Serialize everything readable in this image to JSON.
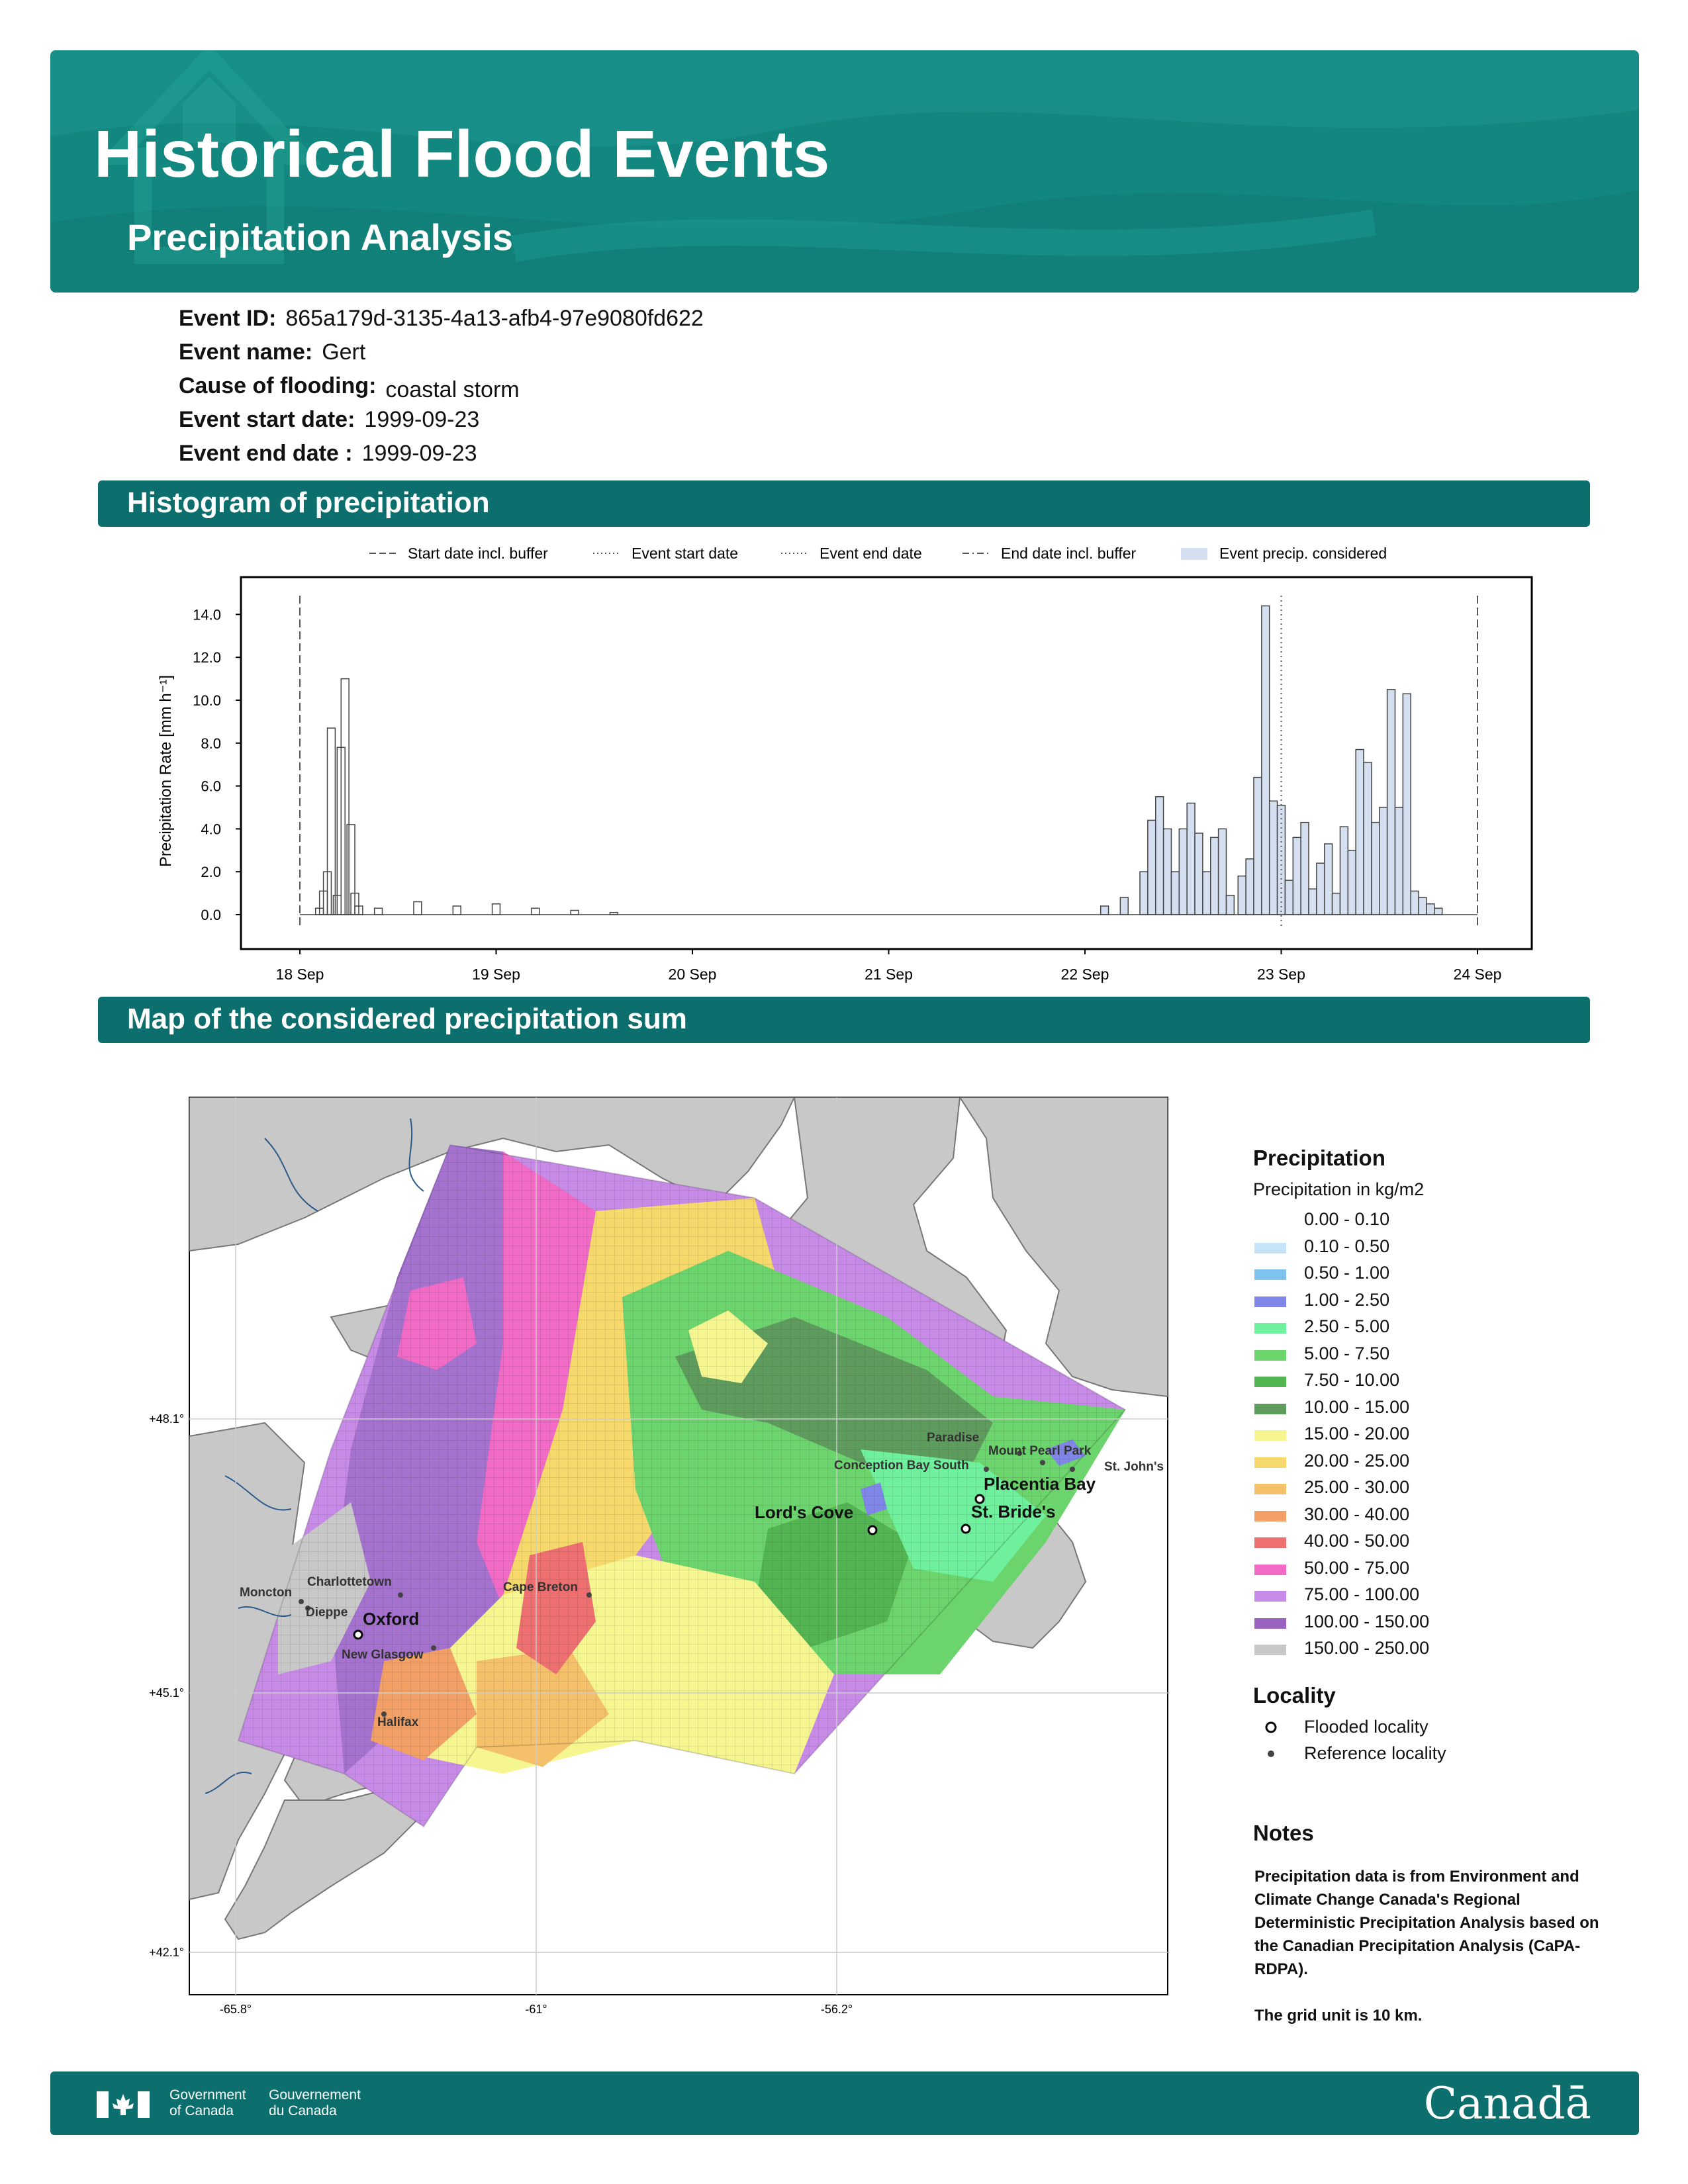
{
  "header": {
    "title": "Historical Flood Events",
    "subtitle": "Precipitation Analysis"
  },
  "event": {
    "id_label": "Event ID:",
    "id": "865a179d-3135-4a13-afb4-97e9080fd622",
    "name_label": "Event name:",
    "name": "Gert",
    "cause_label": "Cause of flooding:",
    "cause": "coastal storm",
    "start_label": "Event start date:",
    "start": "1999-09-23",
    "end_label": "Event end date :",
    "end": "1999-09-23"
  },
  "sections": {
    "histogram": "Histogram of precipitation",
    "map": "Map of the considered precipitation sum"
  },
  "chart_data": {
    "type": "bar",
    "ylabel": "Precipitation Rate [mm h⁻¹]",
    "ylim": [
      -1.5,
      16
    ],
    "yticks": [
      "0.0",
      "2.0",
      "4.0",
      "6.0",
      "8.0",
      "10.0",
      "12.0",
      "14.0"
    ],
    "xticks": [
      "18 Sep",
      "19 Sep",
      "20 Sep",
      "21 Sep",
      "22 Sep",
      "23 Sep",
      "24 Sep"
    ],
    "legend": [
      "Start date incl. buffer",
      "Event start date",
      "Event end date",
      "End date incl. buffer",
      "Event precip. considered"
    ],
    "markers": {
      "start_buffer": "18 Sep",
      "event_start": "23 Sep",
      "event_end": "23 Sep",
      "end_buffer": "24 Sep"
    },
    "series": [
      {
        "points": [
          [
            0.1,
            0.3
          ],
          [
            0.12,
            1.1
          ],
          [
            0.14,
            2.0
          ],
          [
            0.16,
            8.7
          ],
          [
            0.19,
            0.9
          ],
          [
            0.21,
            7.8
          ],
          [
            0.23,
            11.0
          ],
          [
            0.26,
            4.2
          ],
          [
            0.28,
            1.0
          ],
          [
            0.3,
            0.4
          ],
          [
            0.4,
            0.3
          ],
          [
            0.6,
            0.6
          ],
          [
            0.8,
            0.4
          ],
          [
            1.0,
            0.5
          ],
          [
            1.2,
            0.3
          ],
          [
            1.4,
            0.2
          ],
          [
            1.6,
            0.1
          ]
        ]
      },
      {
        "points": [
          [
            4.1,
            0.4
          ],
          [
            4.2,
            0.8
          ],
          [
            4.3,
            2.0
          ],
          [
            4.34,
            4.4
          ],
          [
            4.38,
            5.5
          ],
          [
            4.42,
            4.0
          ],
          [
            4.46,
            2.0
          ],
          [
            4.5,
            4.0
          ],
          [
            4.54,
            5.2
          ],
          [
            4.58,
            3.8
          ],
          [
            4.62,
            2.0
          ],
          [
            4.66,
            3.6
          ],
          [
            4.7,
            4.0
          ],
          [
            4.74,
            0.9
          ],
          [
            4.8,
            1.8
          ],
          [
            4.84,
            2.6
          ],
          [
            4.88,
            6.4
          ],
          [
            4.92,
            14.4
          ],
          [
            4.96,
            5.3
          ],
          [
            5.0,
            5.1
          ],
          [
            5.04,
            1.6
          ],
          [
            5.08,
            3.6
          ],
          [
            5.12,
            4.3
          ],
          [
            5.16,
            1.2
          ],
          [
            5.2,
            2.4
          ],
          [
            5.24,
            3.3
          ],
          [
            5.28,
            1.0
          ],
          [
            5.32,
            4.1
          ],
          [
            5.36,
            3.0
          ],
          [
            5.4,
            7.7
          ],
          [
            5.44,
            7.1
          ],
          [
            5.48,
            4.3
          ],
          [
            5.52,
            5.0
          ],
          [
            5.56,
            10.5
          ],
          [
            5.6,
            5.0
          ],
          [
            5.64,
            10.3
          ],
          [
            5.68,
            1.1
          ],
          [
            5.72,
            0.8
          ],
          [
            5.76,
            0.5
          ],
          [
            5.8,
            0.3
          ]
        ]
      }
    ]
  },
  "map": {
    "lat_labels": [
      "+48.1°",
      "+45.1°",
      "+42.1°"
    ],
    "lon_labels": [
      "-65.8°",
      "-61°",
      "-56.2°"
    ],
    "flooded": [
      {
        "name": "Placentia Bay"
      },
      {
        "name": "Lord's Cove"
      },
      {
        "name": "St. Bride's"
      },
      {
        "name": "Oxford"
      }
    ],
    "reference": [
      {
        "name": "Paradise"
      },
      {
        "name": "Mount Pearl Park"
      },
      {
        "name": "St. John's"
      },
      {
        "name": "Conception Bay South"
      },
      {
        "name": "Charlottetown"
      },
      {
        "name": "Moncton"
      },
      {
        "name": "Dieppe"
      },
      {
        "name": "New Glasgow"
      },
      {
        "name": "Cape Breton"
      },
      {
        "name": "Halifax"
      }
    ]
  },
  "legend": {
    "precip_title": "Precipitation",
    "precip_sub": "Precipitation in kg/m2",
    "classes": [
      {
        "label": "0.00 - 0.10",
        "color": "#ffffff"
      },
      {
        "label": "0.10 - 0.50",
        "color": "#c6e3f7"
      },
      {
        "label": "0.50 - 1.00",
        "color": "#7ec3f0"
      },
      {
        "label": "1.00 - 2.50",
        "color": "#7f86e8"
      },
      {
        "label": "2.50 - 5.00",
        "color": "#6ef09c"
      },
      {
        "label": "5.00 - 7.50",
        "color": "#6cd46c"
      },
      {
        "label": "7.50 - 10.00",
        "color": "#52b552"
      },
      {
        "label": "10.00 - 15.00",
        "color": "#5e9c5e"
      },
      {
        "label": "15.00 - 20.00",
        "color": "#f6f690"
      },
      {
        "label": "20.00 - 25.00",
        "color": "#f6d96a"
      },
      {
        "label": "25.00 - 30.00",
        "color": "#f5c06a"
      },
      {
        "label": "30.00 - 40.00",
        "color": "#f2a065"
      },
      {
        "label": "40.00 - 50.00",
        "color": "#ee6f6f"
      },
      {
        "label": "50.00 - 75.00",
        "color": "#f06ac6"
      },
      {
        "label": "75.00 - 100.00",
        "color": "#c78ae6"
      },
      {
        "label": "100.00 - 150.00",
        "color": "#9a63c0"
      },
      {
        "label": "150.00 - 250.00",
        "color": "#c8c8c8"
      }
    ],
    "locality_title": "Locality",
    "flooded_label": "Flooded locality",
    "reference_label": "Reference locality",
    "notes_title": "Notes",
    "notes_1": "Precipitation data is from Environment and Climate Change Canada's Regional Deterministic Precipitation Analysis based on the Canadian Precipitation Analysis (CaPA-RDPA).",
    "notes_2": "The grid unit is 10 km."
  },
  "footer": {
    "gov_en_1": "Government",
    "gov_en_2": "of Canada",
    "gov_fr_1": "Gouvernement",
    "gov_fr_2": "du Canada",
    "wordmark": "Canadā"
  }
}
